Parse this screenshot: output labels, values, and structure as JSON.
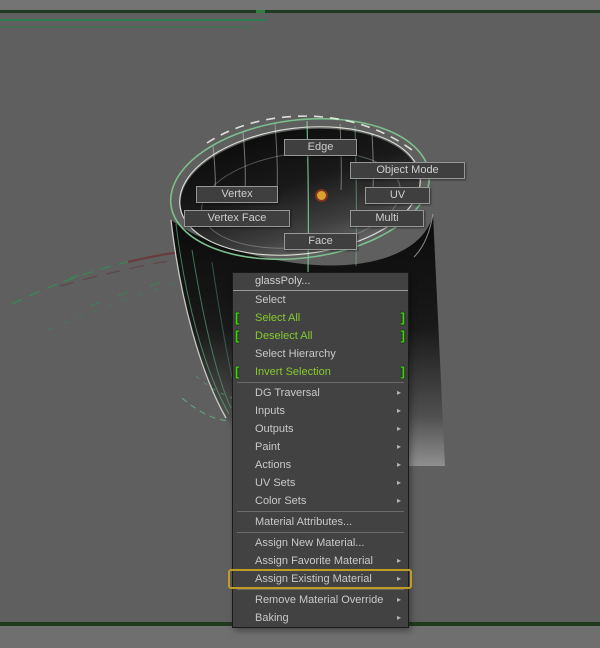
{
  "viewport": {
    "background": "#5f5f5f",
    "top_band_color": "#747474",
    "bottom_band_color": "#6f6f6f",
    "grid_green": "#2e7d52",
    "wireframe_green": "#7cbf8e",
    "wireframe_highlight": "#e8efe3",
    "dot_orange": "#d9a12f"
  },
  "glyphs": {
    "submenu_arrow": "▸",
    "bracket_left": "[",
    "bracket_right": "]"
  },
  "marking_menu": {
    "items": [
      {
        "label": "Edge"
      },
      {
        "label": "Object Mode"
      },
      {
        "label": "Vertex"
      },
      {
        "label": "UV"
      },
      {
        "label": "Vertex Face"
      },
      {
        "label": "Multi"
      },
      {
        "label": "Face"
      }
    ]
  },
  "context_menu": {
    "accent_green": "#86ca2f",
    "bracket_green": "#3fd10a",
    "highlight_gold": "#bf9b28",
    "items": [
      {
        "label": "glassPoly...",
        "type": "title"
      },
      {
        "label": "Select"
      },
      {
        "label": "Select All",
        "green": true,
        "brackets": true
      },
      {
        "label": "Deselect All",
        "green": true,
        "brackets": true
      },
      {
        "label": "Select Hierarchy"
      },
      {
        "label": "Invert Selection",
        "green": true,
        "brackets": true
      },
      {
        "label": "DG Traversal",
        "submenu": true
      },
      {
        "label": "Inputs",
        "submenu": true
      },
      {
        "label": "Outputs",
        "submenu": true
      },
      {
        "label": "Paint",
        "submenu": true
      },
      {
        "label": "Actions",
        "submenu": true
      },
      {
        "label": "UV Sets",
        "submenu": true
      },
      {
        "label": "Color Sets",
        "submenu": true
      },
      {
        "label": "Material Attributes..."
      },
      {
        "label": "Assign New Material..."
      },
      {
        "label": "Assign Favorite Material",
        "submenu": true
      },
      {
        "label": "Assign Existing Material",
        "submenu": true,
        "highlighted": true
      },
      {
        "label": "Remove Material Override",
        "submenu": true
      },
      {
        "label": "Baking",
        "submenu": true
      }
    ]
  }
}
